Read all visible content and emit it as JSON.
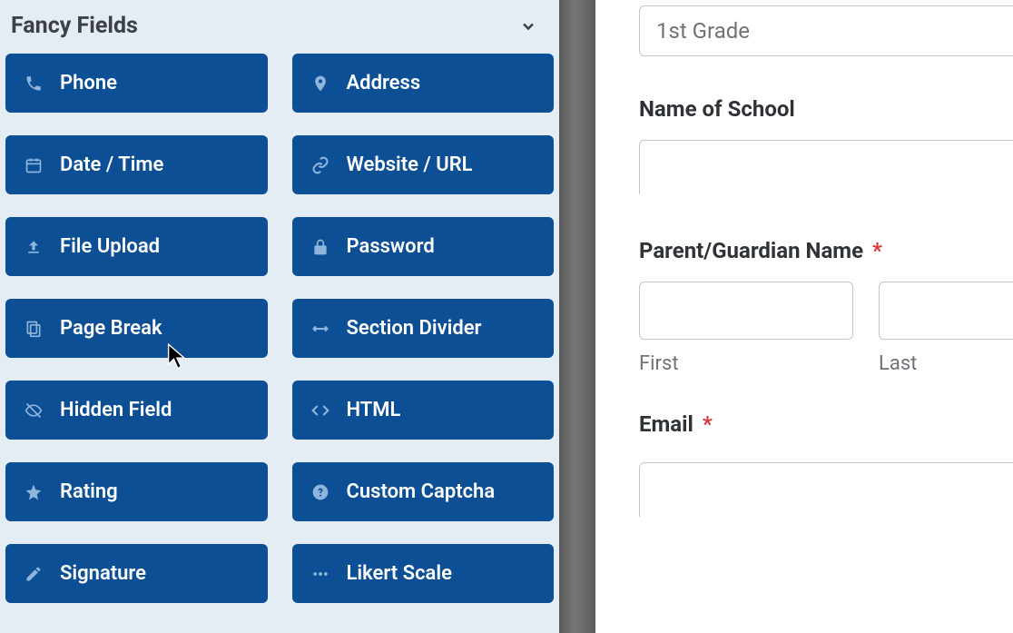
{
  "sidebar": {
    "title": "Fancy Fields",
    "fields": [
      {
        "icon": "phone-icon",
        "label": "Phone"
      },
      {
        "icon": "pin-icon",
        "label": "Address"
      },
      {
        "icon": "calendar-icon",
        "label": "Date / Time"
      },
      {
        "icon": "link-icon",
        "label": "Website / URL"
      },
      {
        "icon": "upload-icon",
        "label": "File Upload"
      },
      {
        "icon": "lock-icon",
        "label": "Password"
      },
      {
        "icon": "pagebreak-icon",
        "label": "Page Break"
      },
      {
        "icon": "divider-icon",
        "label": "Section Divider"
      },
      {
        "icon": "hidden-icon",
        "label": "Hidden Field"
      },
      {
        "icon": "code-icon",
        "label": "HTML"
      },
      {
        "icon": "star-icon",
        "label": "Rating"
      },
      {
        "icon": "question-icon",
        "label": "Custom Captcha"
      },
      {
        "icon": "pencil-icon",
        "label": "Signature"
      },
      {
        "icon": "dots-icon",
        "label": "Likert Scale"
      }
    ]
  },
  "form": {
    "grade_value": "1st Grade",
    "school_label": "Name of School",
    "school_value": "",
    "parent_label": "Parent/Guardian Name",
    "parent_required": "*",
    "first_sub": "First",
    "last_sub": "Last",
    "email_label": "Email",
    "email_required": "*"
  }
}
